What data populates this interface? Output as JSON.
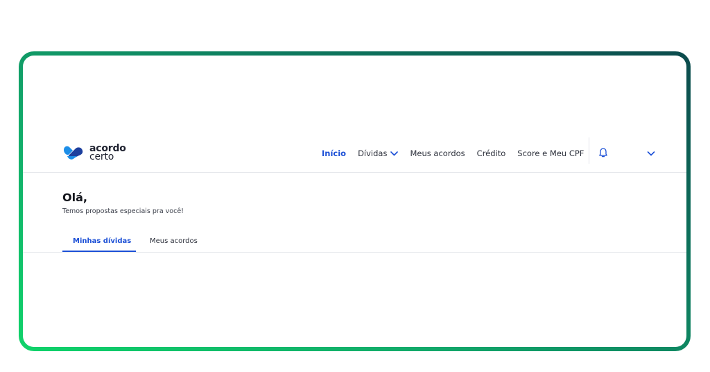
{
  "brand": {
    "name_top": "acordo",
    "name_bottom": "certo",
    "logo_icon": "heart-hands-logo"
  },
  "nav": {
    "items": [
      {
        "label": "Início",
        "active": true
      },
      {
        "label": "Dívidas",
        "has_dropdown": true
      },
      {
        "label": "Meus acordos"
      },
      {
        "label": "Crédito"
      },
      {
        "label": "Score e Meu CPF"
      }
    ],
    "bell_icon": "bell-icon",
    "user_menu_icon": "chevron-down-icon"
  },
  "main": {
    "greeting": "Olá,",
    "subtitle": "Temos propostas especiais pra você!",
    "tabs": [
      {
        "label": "Minhas dívidas",
        "active": true
      },
      {
        "label": "Meus acordos"
      }
    ]
  },
  "colors": {
    "accent": "#1b4fd6",
    "frame_gradient_start": "#10d36a",
    "frame_gradient_end": "#0b4a4c",
    "logo_blue": "#1c8ee8",
    "logo_navy": "#1c3f9e"
  }
}
